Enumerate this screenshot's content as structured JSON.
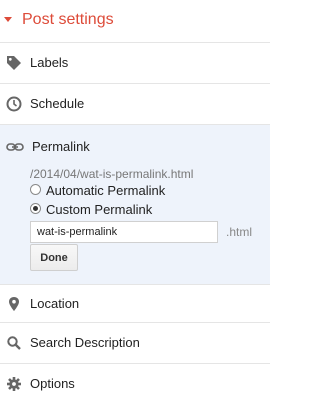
{
  "header": {
    "title": "Post settings"
  },
  "items": {
    "labels": {
      "label": "Labels",
      "icon": "tag-icon"
    },
    "schedule": {
      "label": "Schedule",
      "icon": "clock-icon"
    },
    "permalink": {
      "label": "Permalink",
      "icon": "link-icon"
    },
    "location": {
      "label": "Location",
      "icon": "map-pin-icon"
    },
    "search_description": {
      "label": "Search Description",
      "icon": "search-icon"
    },
    "options": {
      "label": "Options",
      "icon": "gear-icon"
    }
  },
  "permalink_panel": {
    "path": "/2014/04/wat-is-permalink.html",
    "automatic_label": "Automatic Permalink",
    "custom_label": "Custom Permalink",
    "selected": "custom",
    "slug_value": "wat-is-permalink",
    "extension": ".html",
    "done_label": "Done"
  },
  "colors": {
    "accent": "#dd4b39",
    "panel_bg": "#eef3fb",
    "icon": "#666666"
  }
}
